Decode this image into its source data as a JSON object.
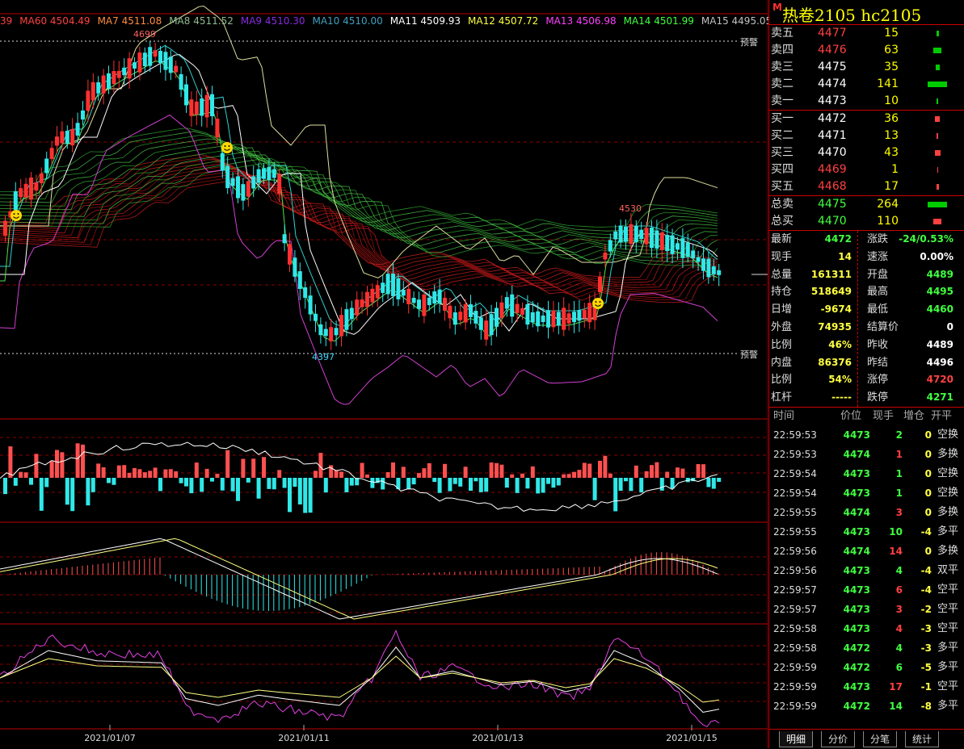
{
  "ma_legend": [
    {
      "label": "39",
      "color": "#ff4040"
    },
    {
      "label": "MA60 4504.49",
      "color": "#ff4040"
    },
    {
      "label": "MA7 4511.08",
      "color": "#ff8c40"
    },
    {
      "label": "MA8 4511.52",
      "color": "#8fbc8f"
    },
    {
      "label": "MA9 4510.30",
      "color": "#8a2be2"
    },
    {
      "label": "MA10 4510.00",
      "color": "#40a0c0"
    },
    {
      "label": "MA11 4509.93",
      "color": "#ffffff"
    },
    {
      "label": "MA12 4507.72",
      "color": "#ffff40"
    },
    {
      "label": "MA13 4506.98",
      "color": "#ff40ff"
    },
    {
      "label": "MA14 4501.99",
      "color": "#40ff40"
    },
    {
      "label": "MA15 4495.05",
      "color": "#c0c0c0"
    }
  ],
  "chart_labels": {
    "warn_top": "预警",
    "warn_bottom": "预警",
    "high": "4699",
    "low": "4397",
    "local_high": "4530"
  },
  "dates": [
    "2021/01/07",
    "2021/01/11",
    "2021/01/13",
    "2021/01/15"
  ],
  "title": {
    "marker": "M",
    "text": "热卷2105  hc2105"
  },
  "asks": [
    {
      "label": "卖五",
      "price": "4477",
      "vol": "15",
      "bar": 3,
      "color": "#ff4040"
    },
    {
      "label": "卖四",
      "price": "4476",
      "vol": "63",
      "bar": 10,
      "color": "#ff4040"
    },
    {
      "label": "卖三",
      "price": "4475",
      "vol": "35",
      "bar": 5,
      "color": "#ffffff"
    },
    {
      "label": "卖二",
      "price": "4474",
      "vol": "141",
      "bar": 24,
      "color": "#ffffff"
    },
    {
      "label": "卖一",
      "price": "4473",
      "vol": "10",
      "bar": 2,
      "color": "#ffffff"
    }
  ],
  "bids": [
    {
      "label": "买一",
      "price": "4472",
      "vol": "36",
      "bar": 6,
      "color": "#ffffff"
    },
    {
      "label": "买二",
      "price": "4471",
      "vol": "13",
      "bar": 2,
      "color": "#ffffff"
    },
    {
      "label": "买三",
      "price": "4470",
      "vol": "43",
      "bar": 7,
      "color": "#ffffff"
    },
    {
      "label": "买四",
      "price": "4469",
      "vol": "1",
      "bar": 0,
      "color": "#ff4040"
    },
    {
      "label": "买五",
      "price": "4468",
      "vol": "17",
      "bar": 3,
      "color": "#ff4040"
    }
  ],
  "totals": [
    {
      "label": "总卖",
      "price": "4475",
      "vol": "264",
      "bar": 24,
      "pcolor": "#40ff40",
      "barcolor": "#00cc00"
    },
    {
      "label": "总买",
      "price": "4470",
      "vol": "110",
      "bar": 10,
      "pcolor": "#40ff40",
      "barcolor": "#ff4040"
    }
  ],
  "stats": [
    {
      "l1": "最新",
      "v1": "4472",
      "c1": "#40ff40",
      "l2": "涨跌",
      "v2": "-24/0.53%",
      "c2": "#40ff40"
    },
    {
      "l1": "现手",
      "v1": "14",
      "c1": "#ffff40",
      "l2": "速涨",
      "v2": "0.00%",
      "c2": "#ffffff"
    },
    {
      "l1": "总量",
      "v1": "161311",
      "c1": "#ffff40",
      "l2": "开盘",
      "v2": "4489",
      "c2": "#40ff40"
    },
    {
      "l1": "持仓",
      "v1": "518649",
      "c1": "#ffff40",
      "l2": "最高",
      "v2": "4495",
      "c2": "#40ff40"
    },
    {
      "l1": "日增",
      "v1": "-9674",
      "c1": "#ffff40",
      "l2": "最低",
      "v2": "4460",
      "c2": "#40ff40"
    },
    {
      "l1": "外盘",
      "v1": "74935",
      "c1": "#ffff40",
      "l2": "结算价",
      "v2": "0",
      "c2": "#ffffff"
    },
    {
      "l1": "比例",
      "v1": "46%",
      "c1": "#ffff40",
      "l2": "昨收",
      "v2": "4489",
      "c2": "#ffffff"
    },
    {
      "l1": "内盘",
      "v1": "86376",
      "c1": "#ffff40",
      "l2": "昨结",
      "v2": "4496",
      "c2": "#ffffff"
    },
    {
      "l1": "比例",
      "v1": "54%",
      "c1": "#ffff40",
      "l2": "涨停",
      "v2": "4720",
      "c2": "#ff4040"
    },
    {
      "l1": "杠杆",
      "v1": "-----",
      "c1": "#ffff40",
      "l2": "跌停",
      "v2": "4271",
      "c2": "#40ff40"
    }
  ],
  "tick_header": {
    "time": "时间",
    "price": "价位",
    "qty": "现手",
    "oi": "增仓",
    "type": "开平"
  },
  "ticks": [
    {
      "time": "22:59:53",
      "price": "4473",
      "pc": "#40ff40",
      "qty": "2",
      "qc": "#40ff40",
      "oi": "0",
      "oc": "#ffff40",
      "type": "空换"
    },
    {
      "time": "22:59:53",
      "price": "4474",
      "pc": "#40ff40",
      "qty": "1",
      "qc": "#ff4040",
      "oi": "0",
      "oc": "#ffff40",
      "type": "多换"
    },
    {
      "time": "22:59:54",
      "price": "4473",
      "pc": "#40ff40",
      "qty": "1",
      "qc": "#40ff40",
      "oi": "0",
      "oc": "#ffff40",
      "type": "空换"
    },
    {
      "time": "22:59:54",
      "price": "4473",
      "pc": "#40ff40",
      "qty": "1",
      "qc": "#40ff40",
      "oi": "0",
      "oc": "#ffff40",
      "type": "空换"
    },
    {
      "time": "22:59:55",
      "price": "4474",
      "pc": "#40ff40",
      "qty": "3",
      "qc": "#ff4040",
      "oi": "0",
      "oc": "#ffff40",
      "type": "多换"
    },
    {
      "time": "22:59:55",
      "price": "4473",
      "pc": "#40ff40",
      "qty": "10",
      "qc": "#40ff40",
      "oi": "-4",
      "oc": "#ffff40",
      "type": "多平"
    },
    {
      "time": "22:59:56",
      "price": "4474",
      "pc": "#40ff40",
      "qty": "14",
      "qc": "#ff4040",
      "oi": "0",
      "oc": "#ffff40",
      "type": "多换"
    },
    {
      "time": "22:59:56",
      "price": "4473",
      "pc": "#40ff40",
      "qty": "4",
      "qc": "#40ff40",
      "oi": "-4",
      "oc": "#ffff40",
      "type": "双平"
    },
    {
      "time": "22:59:57",
      "price": "4473",
      "pc": "#40ff40",
      "qty": "6",
      "qc": "#ff4040",
      "oi": "-4",
      "oc": "#ffff40",
      "type": "空平"
    },
    {
      "time": "22:59:57",
      "price": "4473",
      "pc": "#40ff40",
      "qty": "3",
      "qc": "#ff4040",
      "oi": "-2",
      "oc": "#ffff40",
      "type": "空平"
    },
    {
      "time": "22:59:58",
      "price": "4473",
      "pc": "#40ff40",
      "qty": "4",
      "qc": "#ff4040",
      "oi": "-3",
      "oc": "#ffff40",
      "type": "空平"
    },
    {
      "time": "22:59:58",
      "price": "4472",
      "pc": "#40ff40",
      "qty": "4",
      "qc": "#40ff40",
      "oi": "-3",
      "oc": "#ffff40",
      "type": "多平"
    },
    {
      "time": "22:59:59",
      "price": "4472",
      "pc": "#40ff40",
      "qty": "6",
      "qc": "#40ff40",
      "oi": "-5",
      "oc": "#ffff40",
      "type": "多平"
    },
    {
      "time": "22:59:59",
      "price": "4473",
      "pc": "#40ff40",
      "qty": "17",
      "qc": "#ff4040",
      "oi": "-1",
      "oc": "#ffff40",
      "type": "空平"
    },
    {
      "time": "22:59:59",
      "price": "4472",
      "pc": "#40ff40",
      "qty": "14",
      "qc": "#40ff40",
      "oi": "-8",
      "oc": "#ffff40",
      "type": "多平"
    }
  ],
  "tabs": [
    "明细",
    "分价",
    "分笔",
    "统计"
  ],
  "colors": {
    "up": "#ff3030",
    "down": "#30e8e8",
    "grid": "#8b0000",
    "border": "#c00000"
  }
}
